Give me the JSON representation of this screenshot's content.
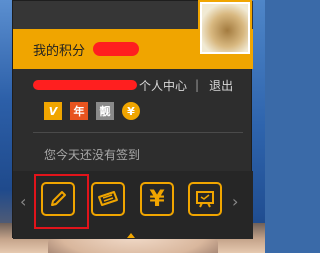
{
  "points": {
    "label": "我的积分",
    "value": "████"
  },
  "user": {
    "name": "████████████",
    "center_link": "个人中心",
    "separator": "|",
    "logout_link": "退出"
  },
  "badges": [
    {
      "icon": "vip-badge-icon",
      "text": "V"
    },
    {
      "icon": "year-badge-icon",
      "text": "年"
    },
    {
      "icon": "cool-badge-icon",
      "text": "靓"
    },
    {
      "icon": "yen-badge-icon",
      "text": "¥"
    }
  ],
  "signin": {
    "status": "您今天还没有签到"
  },
  "tools": {
    "prev": "‹",
    "next": "›",
    "yen_symbol": "¥",
    "items": [
      "pen-icon",
      "ticket-icon",
      "yen-icon",
      "board-icon"
    ]
  },
  "colors": {
    "accent": "#f0a500",
    "panel": "#2d2d2d",
    "highlight": "#e1141b",
    "redaction": "#ff1f1f"
  }
}
